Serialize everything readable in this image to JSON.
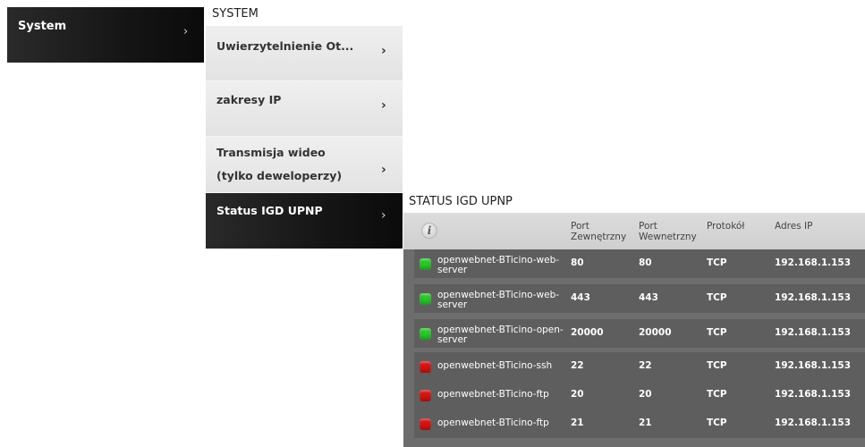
{
  "col1": {
    "label": "System",
    "chevron": "›"
  },
  "col2": {
    "title": "SYSTEM",
    "items": [
      {
        "label": "Uwierzytelnienie Ot...",
        "chevron": "›"
      },
      {
        "label": "zakresy IP",
        "chevron": "›"
      },
      {
        "label_line1": "Transmisja wideo",
        "label_line2": "(tylko deweloperzy)",
        "chevron": "›"
      },
      {
        "label": "Status IGD UPNP",
        "chevron": "›"
      }
    ]
  },
  "col3": {
    "title": "STATUS IGD UPNP",
    "info_icon": "i",
    "headers": {
      "port_ext_1": "Port",
      "port_ext_2": "Zewnętrzny",
      "port_int_1": "Port",
      "port_int_2": "Wewnetrzny",
      "protocol": "Protokół",
      "ip": "Adres IP"
    },
    "rows": [
      {
        "status": "green",
        "name1": "openwebnet-BTicino-web-",
        "name2": "server",
        "ext": "80",
        "int": "80",
        "proto": "TCP",
        "ip": "192.168.1.153"
      },
      {
        "status": "green",
        "name1": "openwebnet-BTicino-web-",
        "name2": "server",
        "ext": "443",
        "int": "443",
        "proto": "TCP",
        "ip": "192.168.1.153"
      },
      {
        "status": "green",
        "name1": "openwebnet-BTicino-open-",
        "name2": "server",
        "ext": "20000",
        "int": "20000",
        "proto": "TCP",
        "ip": "192.168.1.153"
      },
      {
        "status": "red",
        "name1": "openwebnet-BTicino-ssh",
        "name2": "",
        "ext": "22",
        "int": "22",
        "proto": "TCP",
        "ip": "192.168.1.153"
      },
      {
        "status": "red",
        "name1": "openwebnet-BTicino-ftp",
        "name2": "",
        "ext": "20",
        "int": "20",
        "proto": "TCP",
        "ip": "192.168.1.153"
      },
      {
        "status": "red",
        "name1": "openwebnet-BTicino-ftp",
        "name2": "",
        "ext": "21",
        "int": "21",
        "proto": "TCP",
        "ip": "192.168.1.153"
      }
    ]
  },
  "colors": {
    "green": "#2cc82c",
    "red": "#d51414"
  }
}
